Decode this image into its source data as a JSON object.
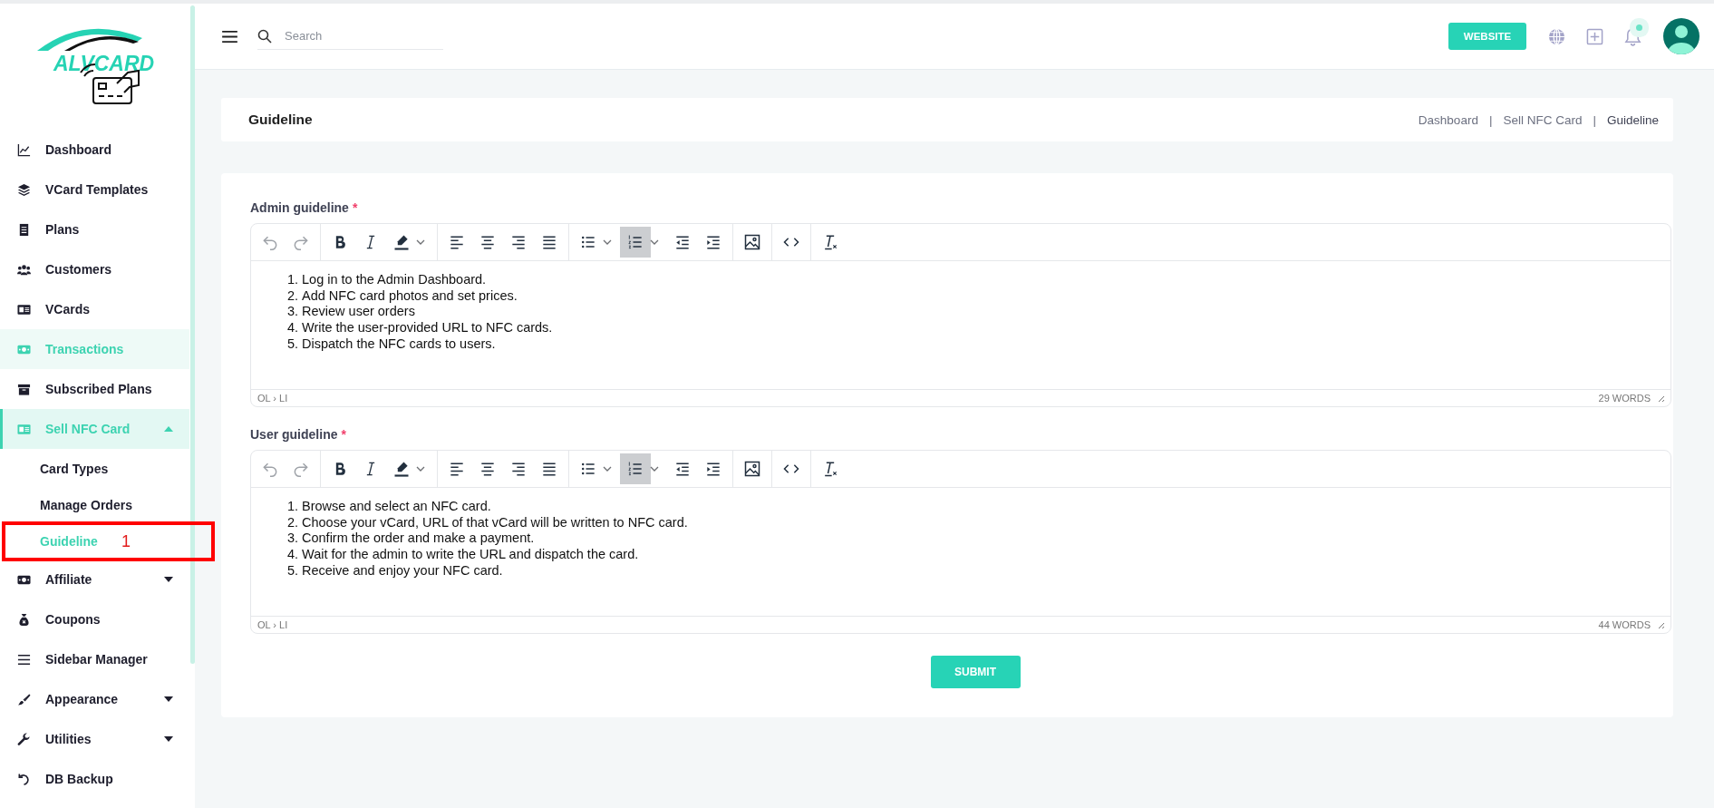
{
  "logo": {
    "text": "ALVCARD"
  },
  "sidebar": {
    "items": [
      {
        "label": "Dashboard",
        "kind": "chart",
        "selected": false,
        "hovered": false
      },
      {
        "label": "VCard Templates",
        "kind": "layers",
        "selected": false,
        "hovered": false
      },
      {
        "label": "Plans",
        "kind": "receipt",
        "selected": false,
        "hovered": false
      },
      {
        "label": "Customers",
        "kind": "users",
        "selected": false,
        "hovered": false
      },
      {
        "label": "VCards",
        "kind": "idcard",
        "selected": false,
        "hovered": false
      },
      {
        "label": "Transactions",
        "kind": "money",
        "selected": false,
        "hovered": true
      },
      {
        "label": "Subscribed Plans",
        "kind": "archive",
        "selected": false,
        "hovered": false
      },
      {
        "label": "Sell NFC Card",
        "kind": "idcard",
        "selected": true,
        "hovered": false,
        "expanded": true,
        "children": [
          {
            "label": "Card Types",
            "selected": false
          },
          {
            "label": "Manage Orders",
            "selected": false
          },
          {
            "label": "Guideline",
            "selected": true,
            "annotation": "1"
          }
        ]
      },
      {
        "label": "Affiliate",
        "kind": "money",
        "selected": false,
        "hovered": false,
        "expanded": false
      },
      {
        "label": "Coupons",
        "kind": "bag",
        "selected": false,
        "hovered": false
      },
      {
        "label": "Sidebar Manager",
        "kind": "bars",
        "selected": false,
        "hovered": false
      },
      {
        "label": "Appearance",
        "kind": "brush",
        "selected": false,
        "hovered": false,
        "expanded": false
      },
      {
        "label": "Utilities",
        "kind": "wrench",
        "selected": false,
        "hovered": false,
        "expanded": false
      },
      {
        "label": "DB Backup",
        "kind": "history",
        "selected": false,
        "hovered": false
      }
    ]
  },
  "topbar": {
    "search": {
      "placeholder": "Search"
    },
    "website_button": "WEBSITE",
    "notification_dot": true
  },
  "page_header": {
    "title": "Guideline",
    "breadcrumb": [
      {
        "label": "Dashboard",
        "kind": "link"
      },
      {
        "label": "|",
        "kind": "separator"
      },
      {
        "label": "Sell NFC Card",
        "kind": "link"
      },
      {
        "label": "|",
        "kind": "separator"
      },
      {
        "label": "Guideline",
        "kind": "current"
      }
    ]
  },
  "editors": [
    {
      "label": "Admin guideline",
      "required_mark": "*",
      "toolbar": [
        [
          {
            "kind": "undo",
            "selected": false,
            "disabled": true,
            "menu": false
          },
          {
            "kind": "redo",
            "selected": false,
            "disabled": true,
            "menu": false
          }
        ],
        [
          {
            "kind": "bold",
            "selected": false,
            "disabled": false,
            "menu": false
          },
          {
            "kind": "italic",
            "selected": false,
            "disabled": false,
            "menu": false
          },
          {
            "kind": "highlight",
            "selected": false,
            "disabled": false,
            "menu": true
          }
        ],
        [
          {
            "kind": "align-left",
            "selected": false,
            "disabled": false,
            "menu": false
          },
          {
            "kind": "align-center",
            "selected": false,
            "disabled": false,
            "menu": false
          },
          {
            "kind": "align-right",
            "selected": false,
            "disabled": false,
            "menu": false
          },
          {
            "kind": "justify",
            "selected": false,
            "disabled": false,
            "menu": false
          }
        ],
        [
          {
            "kind": "bullets",
            "selected": false,
            "disabled": false,
            "menu": true
          },
          {
            "kind": "numbers",
            "selected": true,
            "disabled": false,
            "menu": true
          },
          {
            "kind": "outdent",
            "selected": false,
            "disabled": false,
            "menu": false
          },
          {
            "kind": "indent",
            "selected": false,
            "disabled": false,
            "menu": false
          }
        ],
        [
          {
            "kind": "image",
            "selected": false,
            "disabled": false,
            "menu": false
          }
        ],
        [
          {
            "kind": "code",
            "selected": false,
            "disabled": false,
            "menu": false
          }
        ],
        [
          {
            "kind": "clear",
            "selected": false,
            "disabled": false,
            "menu": false
          }
        ]
      ],
      "items": [
        {
          "number": "1.",
          "text": "Log in to the Admin Dashboard."
        },
        {
          "number": "2.",
          "text": "Add NFC card photos and set prices."
        },
        {
          "number": "3.",
          "text": "Review user orders"
        },
        {
          "number": "4.",
          "text": "Write the user-provided URL to NFC cards."
        },
        {
          "number": "5.",
          "text": "Dispatch the NFC cards to users."
        }
      ],
      "path": "OL › LI",
      "word_count": "29 WORDS"
    },
    {
      "label": "User guideline",
      "required_mark": "*",
      "toolbar": [
        [
          {
            "kind": "undo",
            "selected": false,
            "disabled": true,
            "menu": false
          },
          {
            "kind": "redo",
            "selected": false,
            "disabled": true,
            "menu": false
          }
        ],
        [
          {
            "kind": "bold",
            "selected": false,
            "disabled": false,
            "menu": false
          },
          {
            "kind": "italic",
            "selected": false,
            "disabled": false,
            "menu": false
          },
          {
            "kind": "highlight",
            "selected": false,
            "disabled": false,
            "menu": true
          }
        ],
        [
          {
            "kind": "align-left",
            "selected": false,
            "disabled": false,
            "menu": false
          },
          {
            "kind": "align-center",
            "selected": false,
            "disabled": false,
            "menu": false
          },
          {
            "kind": "align-right",
            "selected": false,
            "disabled": false,
            "menu": false
          },
          {
            "kind": "justify",
            "selected": false,
            "disabled": false,
            "menu": false
          }
        ],
        [
          {
            "kind": "bullets",
            "selected": false,
            "disabled": false,
            "menu": true
          },
          {
            "kind": "numbers",
            "selected": true,
            "disabled": false,
            "menu": true
          },
          {
            "kind": "outdent",
            "selected": false,
            "disabled": false,
            "menu": false
          },
          {
            "kind": "indent",
            "selected": false,
            "disabled": false,
            "menu": false
          }
        ],
        [
          {
            "kind": "image",
            "selected": false,
            "disabled": false,
            "menu": false
          }
        ],
        [
          {
            "kind": "code",
            "selected": false,
            "disabled": false,
            "menu": false
          }
        ],
        [
          {
            "kind": "clear",
            "selected": false,
            "disabled": false,
            "menu": false
          }
        ]
      ],
      "items": [
        {
          "number": "1.",
          "text": "Browse and select an NFC card."
        },
        {
          "number": "2.",
          "text": "Choose your vCard, URL of that vCard will be written to NFC card."
        },
        {
          "number": "3.",
          "text": "Confirm the order and make a payment."
        },
        {
          "number": "4.",
          "text": "Wait for the admin to write the URL and dispatch the card."
        },
        {
          "number": "5.",
          "text": "Receive and enjoy your NFC card."
        }
      ],
      "path": "OL › LI",
      "word_count": "44 WORDS"
    }
  ],
  "submit_button": "SUBMIT"
}
